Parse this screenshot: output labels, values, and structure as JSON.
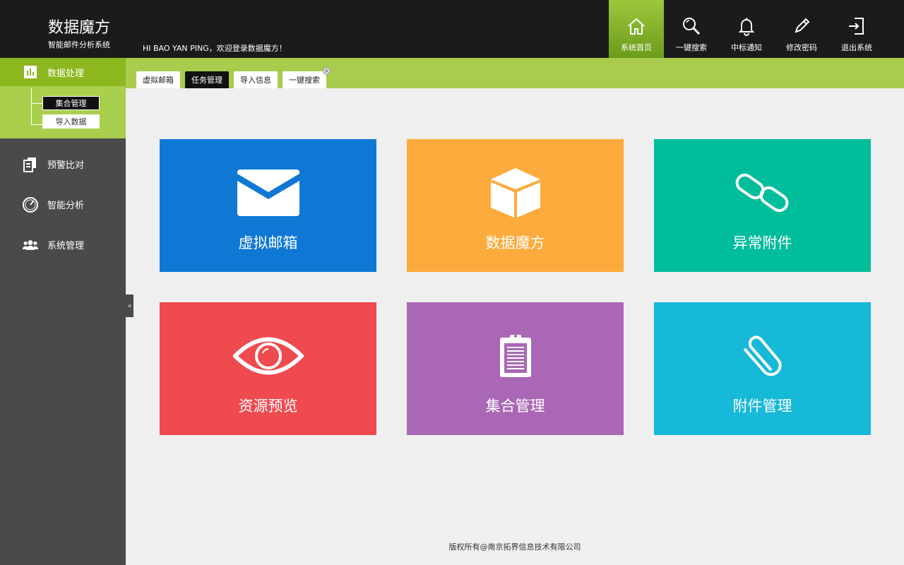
{
  "header": {
    "title": "数据魔方",
    "subtitle": "智能邮件分析系统",
    "welcome": "HI  BAO YAN PING，欢迎登录数据魔方！",
    "nav": [
      {
        "label": "系统首页",
        "icon": "home-icon",
        "active": true
      },
      {
        "label": "一键搜索",
        "icon": "search-icon"
      },
      {
        "label": "中标通知",
        "icon": "bell-icon"
      },
      {
        "label": "修改密码",
        "icon": "pencil-icon"
      },
      {
        "label": "退出系统",
        "icon": "logout-icon"
      }
    ]
  },
  "sidebar": {
    "group": {
      "label": "数据处理",
      "icon": "chart-icon",
      "children": [
        "集合管理",
        "导入数据"
      ]
    },
    "items": [
      {
        "label": "预警比对",
        "icon": "compare-icon"
      },
      {
        "label": "智能分析",
        "icon": "gauge-icon"
      },
      {
        "label": "系统管理",
        "icon": "users-icon"
      }
    ],
    "collapse_glyph": "«"
  },
  "tabs": [
    {
      "label": "虚拟邮箱"
    },
    {
      "label": "任务管理"
    },
    {
      "label": "导入信息"
    },
    {
      "label": "一键搜索"
    }
  ],
  "tiles": [
    {
      "label": "虚拟邮箱",
      "icon": "envelope-icon",
      "color": "#0f78d4"
    },
    {
      "label": "数据魔方",
      "icon": "cube-icon",
      "color": "#fdab3d"
    },
    {
      "label": "异常附件",
      "icon": "link-icon",
      "color": "#00bd9b"
    },
    {
      "label": "资源预览",
      "icon": "eye-icon",
      "color": "#ef4a4f"
    },
    {
      "label": "集合管理",
      "icon": "clipboard-icon",
      "color": "#aa67b5"
    },
    {
      "label": "附件管理",
      "icon": "paperclip-icon",
      "color": "#17b9d8"
    }
  ],
  "footer": "版权所有@南京拓界信息技术有限公司",
  "colors": {
    "header_bg": "#1b1b1b",
    "accent_green": "#8cb71e",
    "tabbar_green": "#a9cc4c",
    "sidebar_bg": "#4a4a4a"
  }
}
